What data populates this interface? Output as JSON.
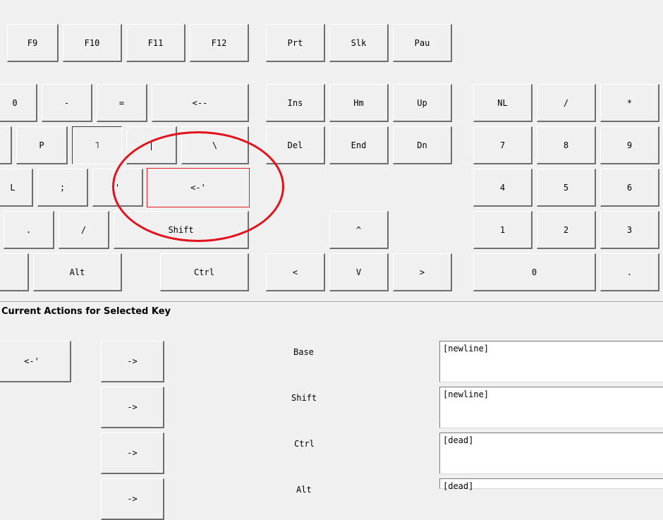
{
  "keyboard": {
    "fn_row": [
      "F9",
      "F10",
      "F11",
      "F12"
    ],
    "sys_row": [
      "Prt",
      "Slk",
      "Pau"
    ],
    "row_num": [
      "0",
      "-",
      "=",
      "<--"
    ],
    "nav_top": [
      "Ins",
      "Hm",
      "Up"
    ],
    "numpad_top": [
      "NL",
      "/",
      "*"
    ],
    "row_p": [
      "P",
      "˥",
      "|",
      "\\"
    ],
    "nav_mid": [
      "Del",
      "End",
      "Dn"
    ],
    "numpad_789": [
      "7",
      "8",
      "9"
    ],
    "row_l": [
      "L",
      ";",
      "'",
      "<-'"
    ],
    "numpad_456": [
      "4",
      "5",
      "6"
    ],
    "row_shift": [
      ".",
      "/",
      "Shift"
    ],
    "arrow_up": "^",
    "numpad_123": [
      "1",
      "2",
      "3"
    ],
    "row_bottom": [
      "Alt",
      "Ctrl"
    ],
    "arrows": [
      "<",
      "V",
      ">"
    ],
    "numpad_bottom": [
      "0",
      "."
    ]
  },
  "section_title": "Current Actions for Selected Key",
  "selected_key": {
    "label": "<-'",
    "arrow_label": "->",
    "modifiers": [
      "Base",
      "Shift",
      "Ctrl",
      "Alt"
    ],
    "actions": [
      "[newline]",
      "[newline]",
      "[dead]",
      "[dead]"
    ]
  },
  "colors": {
    "selection": "#e02020",
    "annotation": "#e2121c",
    "background": "#f0f0f0"
  }
}
